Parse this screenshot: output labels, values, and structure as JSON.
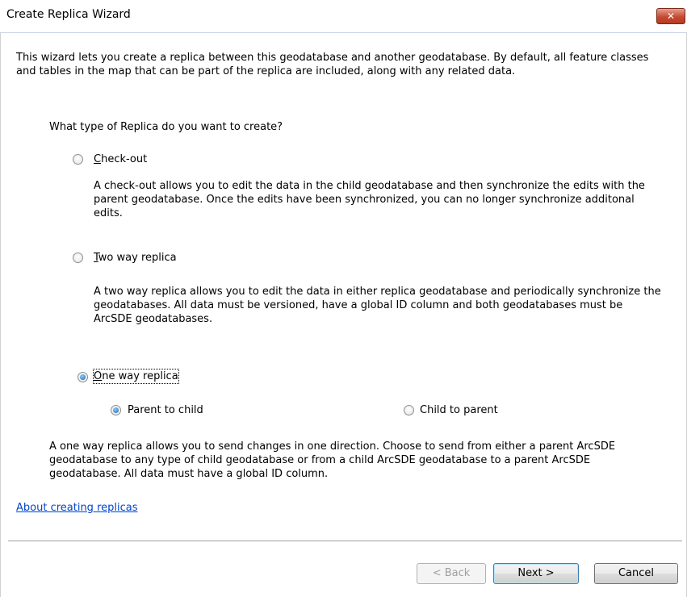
{
  "window": {
    "title": "Create Replica Wizard",
    "close_glyph": "✕"
  },
  "intro": "This wizard lets you create a replica between this geodatabase and another geodatabase. By default, all feature classes and tables in the map that can be part of the replica are included, along with any related data.",
  "question": "What type of Replica do you want to create?",
  "options": [
    {
      "label": "Check-out",
      "mnemonic": "C",
      "selected": false,
      "description": "A check-out allows you to edit the data in the child geodatabase and then synchronize the edits with the parent geodatabase. Once the edits have been synchronized, you can no longer synchronize additonal edits."
    },
    {
      "label": "Two way replica",
      "mnemonic": "T",
      "selected": false,
      "description": "A two way replica allows you to edit the data in either replica geodatabase and periodically synchronize the geodatabases. All data must be versioned, have a global ID column and both geodatabases must be ArcSDE geodatabases."
    },
    {
      "label": "One way replica",
      "mnemonic": "O",
      "selected": true,
      "description": "A one way replica allows you to send changes in one direction. Choose to send from either a parent ArcSDE geodatabase to any type of child geodatabase or from a child ArcSDE geodatabase to a parent ArcSDE geodatabase. All data must have a global ID column."
    }
  ],
  "direction": {
    "parent_to_child": {
      "label": "Parent to child",
      "selected": true
    },
    "child_to_parent": {
      "label": "Child to parent",
      "selected": false
    }
  },
  "link": "About creating replicas",
  "buttons": {
    "back": "< Back",
    "next": "Next >",
    "cancel": "Cancel"
  },
  "colors": {
    "link": "#0044cc",
    "radio_selected": "#1f5fa8",
    "close_button": "#c54a33"
  }
}
